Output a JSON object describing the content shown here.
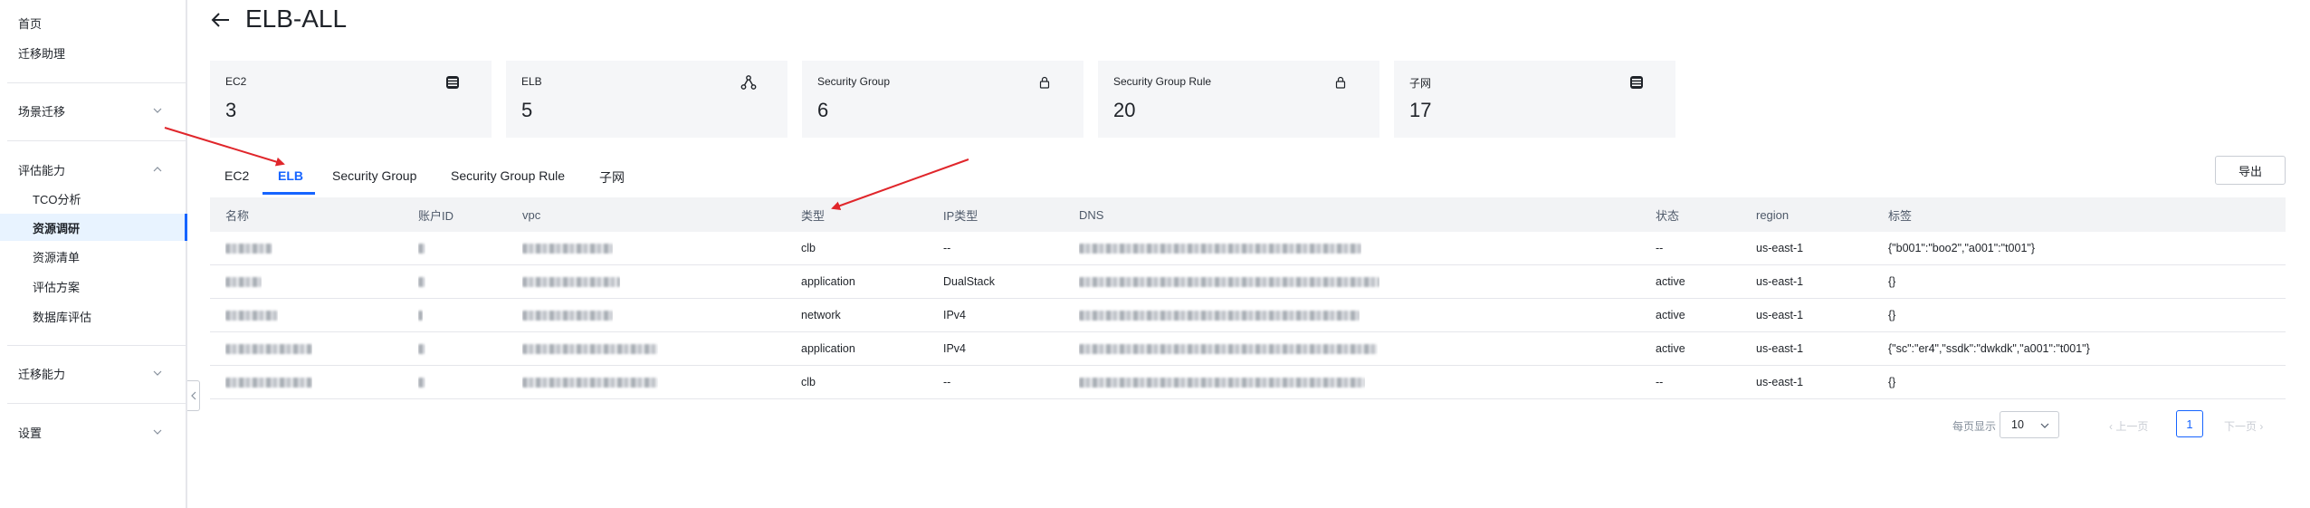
{
  "sidebar": {
    "items": [
      {
        "label": "首页"
      },
      {
        "label": "迁移助理"
      },
      {
        "label": "场景迁移"
      },
      {
        "label": "评估能力"
      },
      {
        "label": "TCO分析"
      },
      {
        "label": "资源调研"
      },
      {
        "label": "资源清单"
      },
      {
        "label": "评估方案"
      },
      {
        "label": "数据库评估"
      },
      {
        "label": "迁移能力"
      },
      {
        "label": "设置"
      }
    ]
  },
  "header": {
    "title": "ELB-ALL"
  },
  "cards": [
    {
      "label": "EC2",
      "value": "3",
      "icon": "server-icon"
    },
    {
      "label": "ELB",
      "value": "5",
      "icon": "load-balancer-icon"
    },
    {
      "label": "Security Group",
      "value": "6",
      "icon": "lock-icon"
    },
    {
      "label": "Security Group Rule",
      "value": "20",
      "icon": "lock-icon"
    },
    {
      "label": "子网",
      "value": "17",
      "icon": "server-icon"
    }
  ],
  "tabs": [
    {
      "label": "EC2"
    },
    {
      "label": "ELB"
    },
    {
      "label": "Security Group"
    },
    {
      "label": "Security Group Rule"
    },
    {
      "label": "子网"
    }
  ],
  "toolbar": {
    "export_label": "导出"
  },
  "table": {
    "columns": [
      "名称",
      "账户ID",
      "vpc",
      "类型",
      "IP类型",
      "DNS",
      "状态",
      "region",
      "标签"
    ],
    "rows": [
      {
        "type": "clb",
        "ip_type": "--",
        "status": "--",
        "region": "us-east-1",
        "tags": "{\"b001\":\"boo2\",\"a001\":\"t001\"}"
      },
      {
        "type": "application",
        "ip_type": "DualStack",
        "status": "active",
        "region": "us-east-1",
        "tags": "{}"
      },
      {
        "type": "network",
        "ip_type": "IPv4",
        "status": "active",
        "region": "us-east-1",
        "tags": "{}"
      },
      {
        "type": "application",
        "ip_type": "IPv4",
        "status": "active",
        "region": "us-east-1",
        "tags": "{\"sc\":\"er4\",\"ssdk\":\"dwkdk\",\"a001\":\"t001\"}"
      },
      {
        "type": "clb",
        "ip_type": "--",
        "status": "--",
        "region": "us-east-1",
        "tags": "{}"
      }
    ]
  },
  "pagination": {
    "page_size_label": "每页显示",
    "page_size": "10",
    "prev_label": "上一页",
    "current_page": "1",
    "next_label": "下一页"
  },
  "colors": {
    "accent": "#1664ff",
    "card_bg": "#f5f6f8",
    "header_bg": "#f2f3f5",
    "annotation": "#e0262b"
  }
}
